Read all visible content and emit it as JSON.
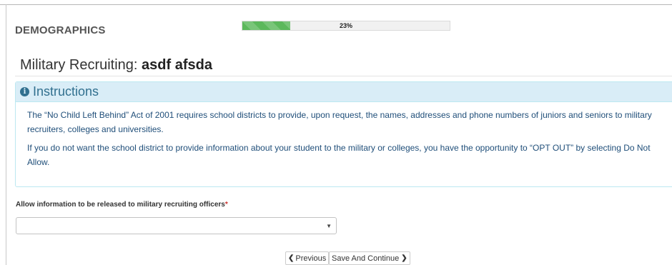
{
  "header": {
    "section_title": "DEMOGRAPHICS",
    "progress": {
      "percent": 23,
      "label": "23%",
      "color": "#5cb85c"
    }
  },
  "page": {
    "heading_prefix": "Military Recruiting:",
    "heading_name": "asdf afsda"
  },
  "instructions": {
    "title": "Instructions",
    "icon": "info-circle-icon",
    "paragraphs": [
      "The “No Child Left Behind” Act of 2001 requires school districts to provide, upon request, the names, addresses and phone numbers of juniors and seniors to military recruiters, colleges and universities.",
      "If you do not want the school district to provide information about your student to the military or colleges, you have the opportunity to “OPT OUT” by selecting Do Not Allow."
    ],
    "colors": {
      "heading_bg": "#d9edf7",
      "heading_text": "#31708f",
      "border": "#bce8f1"
    }
  },
  "form": {
    "field_label": "Allow information to be released to military recruiting officers",
    "required_mark": "*",
    "select_value": ""
  },
  "nav": {
    "previous_label": "Previous",
    "previous_icon": "chevron-left-icon",
    "next_label": "Save And Continue",
    "next_icon": "chevron-right-icon"
  }
}
